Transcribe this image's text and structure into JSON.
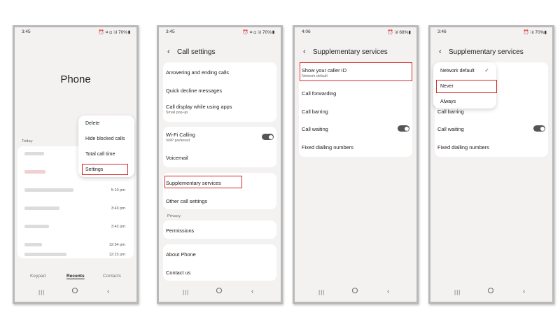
{
  "accent_red": "#d42a2a",
  "screen1": {
    "status_time": "3:45",
    "status_icons": "⏰ ⌗ ⊡ ⁞ıl 70%▮",
    "title": "Phone",
    "today_label": "Today",
    "call_times": [
      "5:10 pm",
      "3:43 pm",
      "3:42 pm",
      "12:54 pm",
      "12:23 pm"
    ],
    "menu": [
      "Delete",
      "Hide blocked calls",
      "Total call time",
      "Settings"
    ],
    "tabs": [
      "Keypad",
      "Recents",
      "Contacts"
    ]
  },
  "screen2": {
    "status_time": "3:45",
    "status_icons": "⏰ ⌗ ⊡ ⁞ıl 70%▮",
    "title": "Call settings",
    "items": {
      "answering": "Answering and ending calls",
      "quick_decline": "Quick decline messages",
      "call_display": "Call display while using apps",
      "call_display_sub": "Small pop-up",
      "wifi_calling": "Wi-Fi Calling",
      "wifi_sub": "VoIP preferred",
      "voicemail": "Voicemail",
      "supplementary": "Supplementary services",
      "other": "Other call settings",
      "privacy_label": "Privacy",
      "permissions": "Permissions",
      "about": "About Phone",
      "contact": "Contact us"
    }
  },
  "screen3": {
    "status_time": "4:06",
    "status_icons": "⏰ ⁞ıl 68%▮",
    "title": "Supplementary services",
    "items": {
      "caller_id": "Show your caller ID",
      "caller_id_sub": "Network default",
      "forwarding": "Call forwarding",
      "barring": "Call barring",
      "waiting": "Call waiting",
      "fixed": "Fixed dialling numbers"
    }
  },
  "screen4": {
    "status_time": "3:46",
    "status_icons": "⏰ ⁞ıl 70%▮",
    "title": "Supplementary services",
    "popup": [
      "Network default",
      "Never",
      "Always"
    ],
    "items": {
      "barring": "Call barring",
      "waiting": "Call waiting",
      "fixed": "Fixed dialling numbers"
    }
  }
}
